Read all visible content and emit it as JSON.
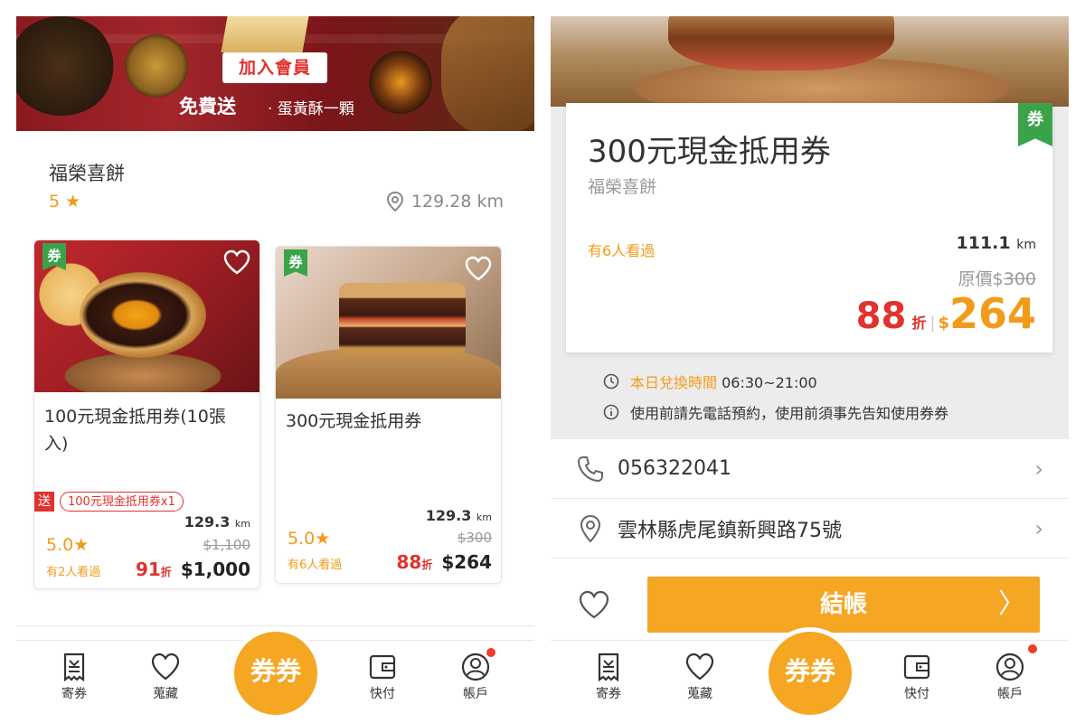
{
  "left": {
    "banner": {
      "join_label": "加入會員",
      "free_label": "免費送",
      "free_item": "· 蛋黃酥一顆"
    },
    "shop": {
      "name": "福榮喜餅",
      "rating": "5",
      "distance": "129.28 km"
    },
    "cards": [
      {
        "tag": "券",
        "title": "100元現金抵用券(10張入)",
        "gift_tag": "送",
        "gift_item": "100元現金抵用券x1",
        "distance_value": "129.3",
        "distance_unit": "km",
        "rating": "5.0",
        "original_price": "$1,100",
        "views": "有2人看過",
        "discount": "91",
        "discount_unit": "折",
        "price": "$1,000"
      },
      {
        "tag": "券",
        "title": "300元現金抵用券",
        "distance_value": "129.3",
        "distance_unit": "km",
        "rating": "5.0",
        "original_price": "$300",
        "views": "有6人看過",
        "discount": "88",
        "discount_unit": "折",
        "price": "$264"
      }
    ]
  },
  "right": {
    "voucher": {
      "title": "300元現金抵用券",
      "shop": "福榮喜餅",
      "tag": "券",
      "views": "有6人看過",
      "distance_value": "111.1",
      "distance_unit": "km",
      "original_label": "原價$",
      "original_price": "300",
      "discount": "88",
      "discount_unit": "折",
      "separator": "|",
      "currency": "$",
      "price": "264"
    },
    "hours_label": "本日兌換時間",
    "hours_value": "06:30~21:00",
    "notice": "使用前請先電話預約，使用前須事先告知使用券券",
    "phone": "056322041",
    "address": "雲林縣虎尾鎮新興路75號",
    "checkout_label": "結帳",
    "checkout_arrow": "〉"
  },
  "tabbar": {
    "items": [
      {
        "label": "寄券",
        "icon": "receipt-icon"
      },
      {
        "label": "蒐藏",
        "icon": "heart-icon"
      },
      {
        "label": "券券",
        "icon": "ticket-logo"
      },
      {
        "label": "快付",
        "icon": "wallet-icon"
      },
      {
        "label": "帳戶",
        "icon": "account-icon"
      }
    ]
  },
  "colors": {
    "accent": "#f5a623",
    "discount": "#e0322e",
    "voucher_tag": "#3aa34a",
    "badge": "#f03a2a"
  }
}
